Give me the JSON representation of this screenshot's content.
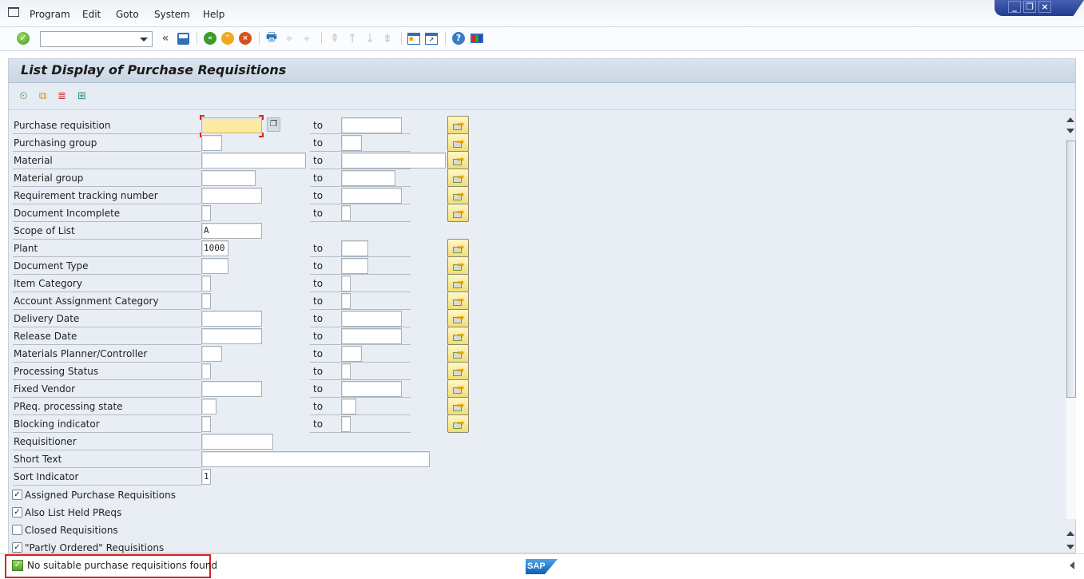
{
  "menubar": {
    "items": [
      "Program",
      "Edit",
      "Goto",
      "System",
      "Help"
    ]
  },
  "window_controls": {
    "minimize": "_",
    "restore": "❐",
    "close": "×"
  },
  "toolbar": {
    "command_field_value": "",
    "icons": [
      "enter-icon",
      "back-icon",
      "save-icon",
      "back-green-icon",
      "exit-icon",
      "cancel-icon",
      "print-icon",
      "find-icon",
      "find-next-icon",
      "first-page-icon",
      "prev-page-icon",
      "next-page-icon",
      "last-page-icon",
      "create-session-icon",
      "shortcut-icon",
      "help-icon",
      "customize-layout-icon"
    ]
  },
  "screen": {
    "title": "List Display of Purchase Requisitions",
    "app_toolbar": [
      "execute-icon",
      "get-variant-icon",
      "dynamic-selections-icon",
      "selection-options-icon"
    ]
  },
  "fields": [
    {
      "label": "Purchase requisition",
      "low": "",
      "to_label": "to",
      "high": "",
      "multi": true
    },
    {
      "label": "Purchasing group",
      "low": "",
      "to_label": "to",
      "high": "",
      "multi": true
    },
    {
      "label": "Material",
      "low": "",
      "to_label": "to",
      "high": "",
      "multi": true
    },
    {
      "label": "Material group",
      "low": "",
      "to_label": "to",
      "high": "",
      "multi": true
    },
    {
      "label": "Requirement tracking number",
      "low": "",
      "to_label": "to",
      "high": "",
      "multi": true
    },
    {
      "label": "Document Incomplete",
      "low": "",
      "to_label": "to",
      "high": "",
      "multi": true
    },
    {
      "label": "Scope of List",
      "low": "A"
    },
    {
      "label": "Plant",
      "low": "1000",
      "to_label": "to",
      "high": "",
      "multi": true
    },
    {
      "label": "Document Type",
      "low": "",
      "to_label": "to",
      "high": "",
      "multi": true
    },
    {
      "label": "Item Category",
      "low": "",
      "to_label": "to",
      "high": "",
      "multi": true
    },
    {
      "label": "Account Assignment Category",
      "low": "",
      "to_label": "to",
      "high": "",
      "multi": true
    },
    {
      "label": "Delivery Date",
      "low": "",
      "to_label": "to",
      "high": "",
      "multi": true
    },
    {
      "label": "Release Date",
      "low": "",
      "to_label": "to",
      "high": "",
      "multi": true
    },
    {
      "label": "Materials Planner/Controller",
      "low": "",
      "to_label": "to",
      "high": "",
      "multi": true
    },
    {
      "label": "Processing Status",
      "low": "",
      "to_label": "to",
      "high": "",
      "multi": true
    },
    {
      "label": "Fixed Vendor",
      "low": "",
      "to_label": "to",
      "high": "",
      "multi": true
    },
    {
      "label": "PReq. processing state",
      "low": "",
      "to_label": "to",
      "high": "",
      "multi": true
    },
    {
      "label": "Blocking indicator",
      "low": "",
      "to_label": "to",
      "high": "",
      "multi": true
    },
    {
      "label": "Requisitioner",
      "low": ""
    },
    {
      "label": "Short Text",
      "low": ""
    },
    {
      "label": "Sort Indicator",
      "low": "1"
    }
  ],
  "checkboxes": [
    {
      "label": "Assigned Purchase Requisitions",
      "checked": true
    },
    {
      "label": "Also List Held PReqs",
      "checked": true
    },
    {
      "label": "Closed Requisitions",
      "checked": false
    },
    {
      "label": "\"Partly Ordered\" Requisitions",
      "checked": true
    }
  ],
  "status_bar": {
    "message": "No suitable purchase requisitions found",
    "type": "success",
    "logo": "SAP"
  }
}
